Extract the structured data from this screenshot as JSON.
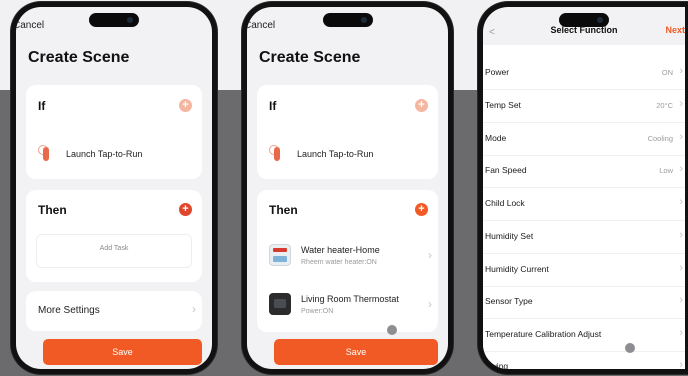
{
  "phone1": {
    "cancel": "Cancel",
    "title": "Create Scene",
    "if_label": "If",
    "trigger_label": "Launch Tap-to-Run",
    "then_label": "Then",
    "add_task": "Add Task",
    "more_settings": "More Settings",
    "save": "Save"
  },
  "phone2": {
    "cancel": "Cancel",
    "title": "Create Scene",
    "if_label": "If",
    "trigger_label": "Launch Tap-to-Run",
    "then_label": "Then",
    "tasks": [
      {
        "name": "Water heater-Home",
        "detail": "Rheem water heater:ON",
        "icon": "water-heater-icon"
      },
      {
        "name": "Living Room Thermostat",
        "detail": "Power:ON",
        "icon": "thermostat-icon"
      }
    ],
    "save": "Save"
  },
  "phone3": {
    "back": "<",
    "title": "Select Function",
    "next": "Next",
    "rows": [
      {
        "label": "Power",
        "value": "ON"
      },
      {
        "label": "Temp Set",
        "value": "20°C"
      },
      {
        "label": "Mode",
        "value": "Cooling"
      },
      {
        "label": "Fan Speed",
        "value": "Low"
      },
      {
        "label": "Child Lock",
        "value": ""
      },
      {
        "label": "Humidity Set",
        "value": ""
      },
      {
        "label": "Humidity Current",
        "value": ""
      },
      {
        "label": "Sensor Type",
        "value": ""
      },
      {
        "label": "Temperature Calibration Adjust",
        "value": ""
      },
      {
        "label": "Swing",
        "value": ""
      }
    ]
  },
  "colors": {
    "accent": "#f25a25",
    "accent_light": "#f5b6a0",
    "card": "#ffffff",
    "screen_bg": "#f2f2f4"
  }
}
